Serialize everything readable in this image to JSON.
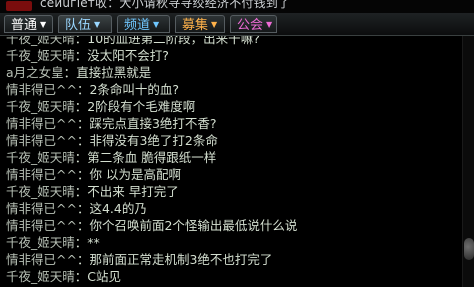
{
  "header_partial_text": "ceйuгieт收：大小请秋寻寻绞经济不付钱到了",
  "tabs": [
    {
      "label": "普通",
      "color": "#ffffff"
    },
    {
      "label": "队伍",
      "color": "#9ad7ff"
    },
    {
      "label": "频道",
      "color": "#6fc7ff"
    },
    {
      "label": "募集",
      "color": "#ffb24a"
    },
    {
      "label": "公会",
      "color": "#ee6bd6"
    }
  ],
  "messages": [
    {
      "speaker": "千夜_姬天晴",
      "sep": "：",
      "text": "10的血进第二阶段，出来干嘛?"
    },
    {
      "speaker": "千夜_姬天晴",
      "sep": "：",
      "text": "没太阳不会打?"
    },
    {
      "speaker": "a月之女皇",
      "sep": "：",
      "text": "直接拉黑就是"
    },
    {
      "speaker": "情非得已^^",
      "sep": "：",
      "text": "2条命叫十的血?"
    },
    {
      "speaker": "千夜_姬天晴",
      "sep": "：",
      "text": "2阶段有个毛难度啊"
    },
    {
      "speaker": "情非得已^^",
      "sep": "：",
      "text": "踩完点直接3绝打不香?"
    },
    {
      "speaker": "情非得已^^",
      "sep": "：",
      "text": "非得没有3绝了打2条命"
    },
    {
      "speaker": "千夜_姬天晴",
      "sep": "：",
      "text": "第二条血 脆得跟纸一样"
    },
    {
      "speaker": "情非得已^^",
      "sep": "：",
      "text": "你 以为是高配啊"
    },
    {
      "speaker": "千夜_姬天晴",
      "sep": "：",
      "text": "不出来 早打完了"
    },
    {
      "speaker": "情非得已^^",
      "sep": "：",
      "text": "这4.4的乃"
    },
    {
      "speaker": "情非得已^^",
      "sep": "：",
      "text": "你个召唤前面2个怪输出最低说什么说"
    },
    {
      "speaker": "千夜_姬天晴",
      "sep": "：",
      "text": "**"
    },
    {
      "speaker": "情非得已^^",
      "sep": "：",
      "text": "那前面正常走机制3绝不也打完了"
    },
    {
      "speaker": "千夜_姬天晴",
      "sep": "：",
      "text": "C站见"
    }
  ],
  "colors": {
    "background": "#000000",
    "chat_text": "#d4dfd0"
  },
  "icons": {
    "scroll_thumb": "round-scroll-thumb"
  }
}
